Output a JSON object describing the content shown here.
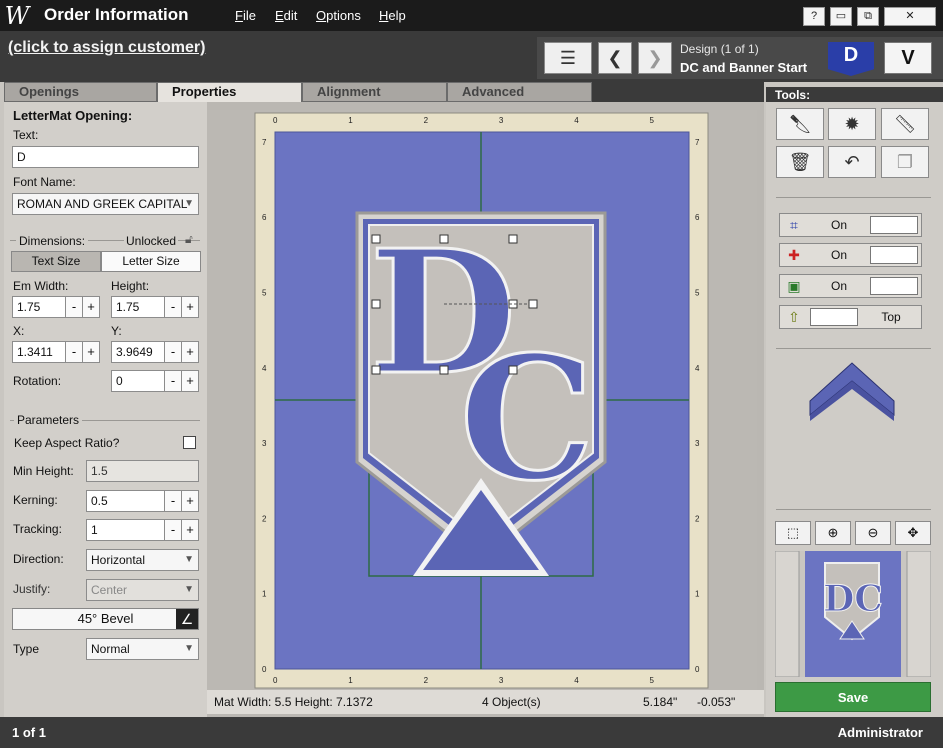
{
  "app": {
    "logo": "W",
    "title": "Order Information"
  },
  "menu": [
    {
      "label": "File"
    },
    {
      "label": "Edit"
    },
    {
      "label": "Options"
    },
    {
      "label": "Help"
    }
  ],
  "window": {
    "help": "?",
    "minimize": "▭",
    "restore": "⧉",
    "close": "✕"
  },
  "header": {
    "assign_customer": "(click to assign customer)",
    "design_label": "Design  (1 of 1)",
    "design_name": "DC and Banner Start",
    "badge_d": "D",
    "badge_v": "V"
  },
  "tabs": [
    {
      "label": "Openings"
    },
    {
      "label": "Properties"
    },
    {
      "label": "Alignment"
    },
    {
      "label": "Advanced"
    }
  ],
  "properties": {
    "section_title": "LetterMat Opening:",
    "text_label": "Text:",
    "text_value": "D",
    "font_label": "Font Name:",
    "font_value": "ROMAN AND GREEK CAPITAL",
    "dimensions_label": "Dimensions:",
    "lock_state": "Unlocked",
    "text_size": "Text Size",
    "letter_size": "Letter Size",
    "em_width_label": "Em Width:",
    "em_width": "1.75",
    "height_label": "Height:",
    "height": "1.75",
    "x_label": "X:",
    "x": "1.3411",
    "y_label": "Y:",
    "y": "3.9649",
    "rotation_label": "Rotation:",
    "rotation": "0",
    "parameters_label": "Parameters",
    "keep_aspect_label": "Keep Aspect Ratio?",
    "min_height_label": "Min Height:",
    "min_height": "1.5",
    "kerning_label": "Kerning:",
    "kerning": "0.5",
    "tracking_label": "Tracking:",
    "tracking": "1",
    "direction_label": "Direction:",
    "direction": "Horizontal",
    "justify_label": "Justify:",
    "justify": "Center",
    "bevel": "45° Bevel",
    "type_label": "Type",
    "type": "Normal",
    "minus": "-",
    "plus": "+"
  },
  "canvas": {
    "ruler_top": [
      "0",
      "1",
      "2",
      "3",
      "4",
      "5"
    ],
    "ruler_side": [
      "7",
      "6",
      "5",
      "4",
      "3",
      "2",
      "1",
      "0"
    ],
    "letters": {
      "first": "D",
      "second": "C"
    },
    "mat_color": "#6b74c2",
    "board_color": "#c4c0bb"
  },
  "status": {
    "mat_size": "Mat  Width: 5.5  Height: 7.1372",
    "objects": "4 Object(s)",
    "coord_x": "5.184\"",
    "coord_y": "-0.053\""
  },
  "tools": {
    "title": "Tools:",
    "toggles": [
      {
        "label": "On"
      },
      {
        "label": "On"
      },
      {
        "label": "On"
      },
      {
        "label": "Top"
      }
    ],
    "save": "Save",
    "preview_letters": "DC"
  },
  "footer": {
    "page": "1 of 1",
    "user": "Administrator"
  }
}
